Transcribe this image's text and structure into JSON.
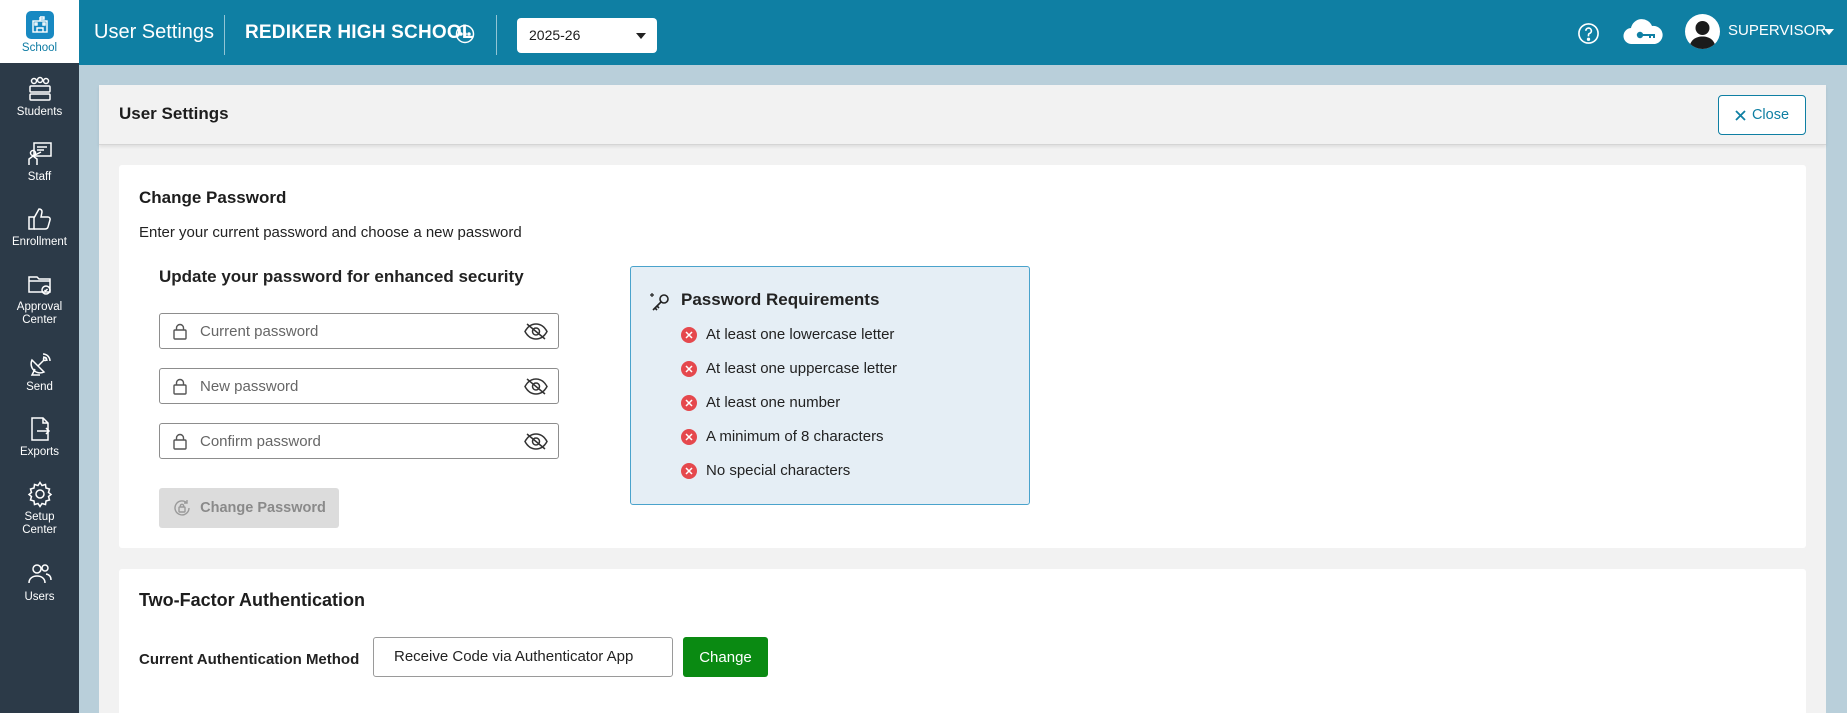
{
  "sidebar": {
    "items": [
      {
        "label": "School",
        "icon": "school-icon",
        "active": true
      },
      {
        "label": "Students",
        "icon": "students-icon"
      },
      {
        "label": "Staff",
        "icon": "staff-icon"
      },
      {
        "label": "Enrollment",
        "icon": "thumbs-up-icon"
      },
      {
        "label": "Approval\nCenter",
        "icon": "approval-folder-icon"
      },
      {
        "label": "Send",
        "icon": "satellite-dish-icon"
      },
      {
        "label": "Exports",
        "icon": "export-file-icon"
      },
      {
        "label": "Setup\nCenter",
        "icon": "gear-icon"
      },
      {
        "label": "Users",
        "icon": "users-icon"
      }
    ]
  },
  "topbar": {
    "title": "User Settings",
    "school": "REDIKER HIGH SCHOOL",
    "year": "2025-26",
    "user": "SUPERVISOR",
    "color": "#0f7fa3"
  },
  "panel": {
    "title": "User Settings",
    "close_label": "Close"
  },
  "password": {
    "heading": "Change Password",
    "description": "Enter your current password and choose a new password",
    "subheading": "Update your password for enhanced security",
    "fields": {
      "current": "Current password",
      "new": "New password",
      "confirm": "Confirm password"
    },
    "button": "Change Password",
    "requirements_title": "Password Requirements",
    "requirements": [
      "At least one lowercase letter",
      "At least one uppercase letter",
      "At least one number",
      "A minimum of 8 characters",
      "No special characters"
    ]
  },
  "tfa": {
    "heading": "Two-Factor Authentication",
    "label": "Current Authentication Method",
    "value": "Receive Code via Authenticator App",
    "button": "Change",
    "button_color": "#0a8a12"
  }
}
